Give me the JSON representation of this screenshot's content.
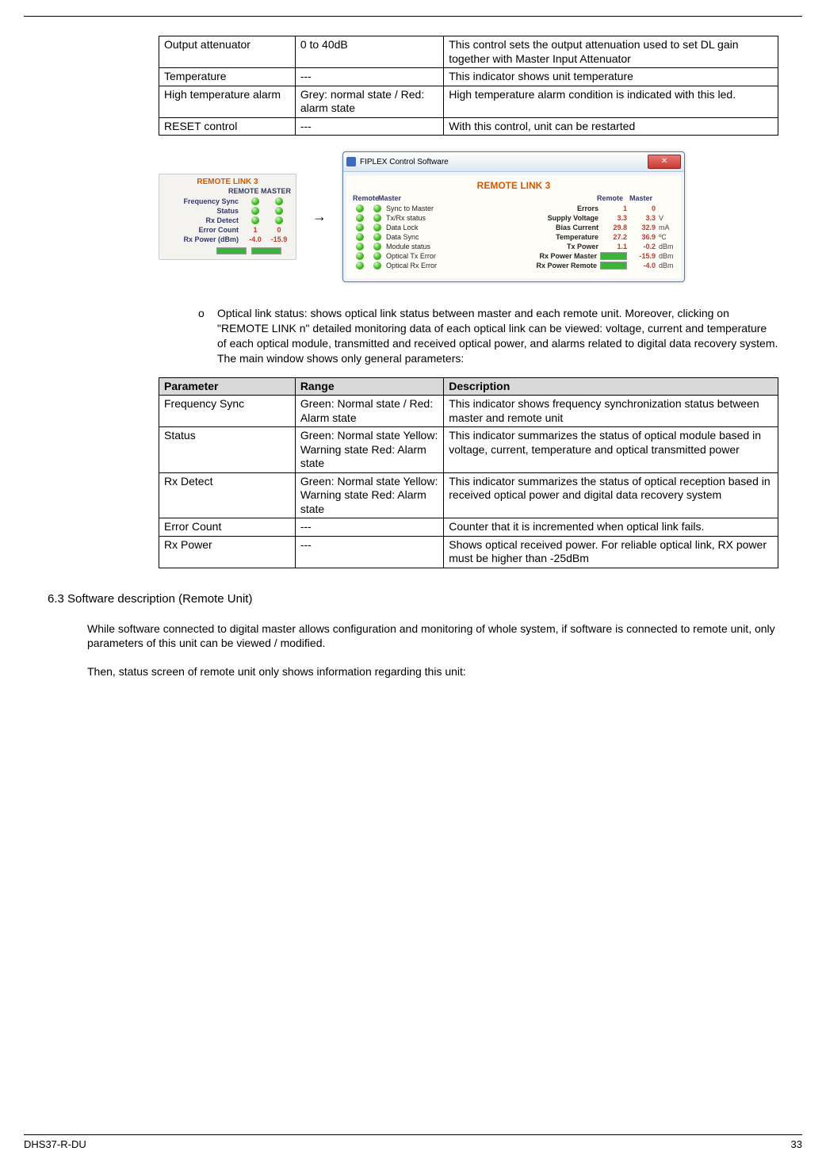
{
  "table1": {
    "rows": [
      {
        "p": "Output attenuator",
        "r": "0 to 40dB",
        "d": "This control sets the output attenuation used to set DL gain together with Master Input Attenuator"
      },
      {
        "p": "Temperature",
        "r": "---",
        "d": "This indicator shows unit temperature"
      },
      {
        "p": "High temperature alarm",
        "r": "Grey: normal state / Red: alarm state",
        "d": "High temperature alarm condition is indicated with this led."
      },
      {
        "p": "RESET control",
        "r": "---",
        "d": "With this control, unit can be restarted"
      }
    ]
  },
  "arrow": "→",
  "panelSmall": {
    "title": "REMOTE LINK 3",
    "hdr": "REMOTE MASTER",
    "labels": {
      "freq": "Frequency Sync",
      "status": "Status",
      "rx": "Rx Detect",
      "err": "Error Count",
      "rxp": "Rx Power (dBm)"
    },
    "err_r": "1",
    "err_m": "0",
    "rxp_r": "-4.0",
    "rxp_m": "-15.9"
  },
  "win": {
    "appTitle": "FIPLEX Control Software",
    "bodyTitle": "REMOTE LINK 3",
    "leftHdr1": "Remote",
    "leftHdr2": "Master",
    "leftRows": [
      "Sync to Master",
      "Tx/Rx status",
      "Data Lock",
      "Data Sync",
      "Module status",
      "Optical Tx Error",
      "Optical Rx Error"
    ],
    "rightHdr1": "Remote",
    "rightHdr2": "Master",
    "rightRows": [
      {
        "l": "Errors",
        "a": "1",
        "b": "0",
        "u": ""
      },
      {
        "l": "Supply Voltage",
        "a": "3.3",
        "b": "3.3",
        "u": "V"
      },
      {
        "l": "Bias Current",
        "a": "29.8",
        "b": "32.9",
        "u": "mA"
      },
      {
        "l": "Temperature",
        "a": "27.2",
        "b": "36.9",
        "u": "ºC"
      },
      {
        "l": "Tx Power",
        "a": "1.1",
        "b": "-0.2",
        "u": "dBm"
      }
    ],
    "barRows": [
      {
        "l": "Rx Power Master",
        "v": "-15.9",
        "u": "dBm"
      },
      {
        "l": "Rx Power Remote",
        "v": "-4.0",
        "u": "dBm"
      }
    ]
  },
  "bullet1": "Optical link status: shows optical link status between master and each remote unit. Moreover, clicking on \"REMOTE LINK n\" detailed monitoring data of each optical link can be viewed: voltage, current and temperature of each optical module, transmitted and received optical power, and alarms related to digital data recovery system. The main window shows only general parameters:",
  "table2": {
    "head": {
      "p": "Parameter",
      "r": "Range",
      "d": "Description"
    },
    "rows": [
      {
        "p": "Frequency Sync",
        "r": "Green: Normal state / Red: Alarm state",
        "d": "This indicator shows frequency synchronization status between master and remote unit"
      },
      {
        "p": "Status",
        "r": "Green: Normal state Yellow: Warning state Red: Alarm state",
        "d": "This indicator summarizes the status of optical module based in voltage, current, temperature and optical transmitted power"
      },
      {
        "p": "Rx Detect",
        "r": "Green: Normal state Yellow: Warning state Red: Alarm state",
        "d": "This indicator summarizes the status of optical reception based in received optical power and digital data recovery system"
      },
      {
        "p": "Error Count",
        "r": "---",
        "d": "Counter that it is incremented when optical link fails."
      },
      {
        "p": "Rx Power",
        "r": "---",
        "d": "Shows optical received power. For reliable optical link, RX power must be higher than -25dBm"
      }
    ]
  },
  "sectionHeading": "6.3  Software description (Remote Unit)",
  "para1": "While software connected to digital master allows configuration and monitoring of whole system, if software is connected to remote unit, only parameters of this unit can be viewed / modified.",
  "para2": "Then, status screen of remote unit only shows information regarding this unit:",
  "footer": {
    "left": "DHS37-R-DU",
    "right": "33"
  }
}
